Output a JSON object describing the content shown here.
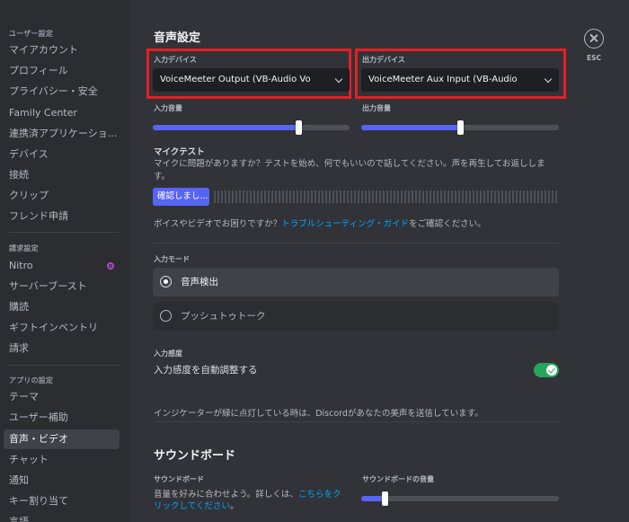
{
  "sidebar": {
    "user_settings_header": "ユーザー設定",
    "user_items": [
      "マイアカウント",
      "プロフィール",
      "プライバシー・安全",
      "Family Center",
      "連携済アプリケーショ...",
      "デバイス",
      "接続",
      "クリップ",
      "フレンド申請"
    ],
    "billing_header": "請求設定",
    "billing_items": [
      "Nitro",
      "サーバーブースト",
      "購読",
      "ギフトインベントリ",
      "請求"
    ],
    "app_header": "アプリの設定",
    "app_items": [
      "テーマ",
      "ユーザー補助",
      "音声・ビデオ",
      "チャット",
      "通知",
      "キー割り当て",
      "言語"
    ],
    "selected_item": "音声・ビデオ"
  },
  "close": {
    "label": "ESC"
  },
  "voice": {
    "title": "音声設定",
    "input_device_label": "入力デバイス",
    "input_device_value": "VoiceMeeter Output (VB-Audio Vo",
    "output_device_label": "出力デバイス",
    "output_device_value": "VoiceMeeter Aux Input (VB-Audio",
    "input_volume_label": "入力音量",
    "input_volume": 0.74,
    "output_volume_label": "出力音量",
    "output_volume": 0.5,
    "mic_test_title": "マイクテスト",
    "mic_test_desc": "マイクに問題がありますか？テストを始め、何でもいいので話してください。声を再生してお返しします。",
    "mic_test_button": "確認しまし...",
    "help_prefix": "ボイスやビデオでお困りですか？",
    "help_link": "トラブルシューティング・ガイド",
    "help_suffix": "をご確認ください。",
    "input_mode_label": "入力モード",
    "mode_voice": "音声検出",
    "mode_ptt": "プッシュトゥトーク",
    "sensitivity_label": "入力感度",
    "auto_sensitivity": "入力感度を自動調整する",
    "auto_sensitivity_enabled": true,
    "indicator_text": "インジケーターが緑に点灯している時は、Discordがあなたの美声を送信しています。"
  },
  "soundboard": {
    "title": "サウンドボード",
    "label": "サウンドボード",
    "desc_prefix": "音量を好みに合わせよう。詳しくは、",
    "desc_link": "こちらをクリックしてください",
    "desc_suffix": "。",
    "volume_label": "サウンドボードの音量",
    "volume": 0.12
  },
  "colors": {
    "accent": "#5865f2",
    "highlight_box": "#e41f25",
    "toggle_on": "#23a55a",
    "link": "#00a8fc"
  }
}
